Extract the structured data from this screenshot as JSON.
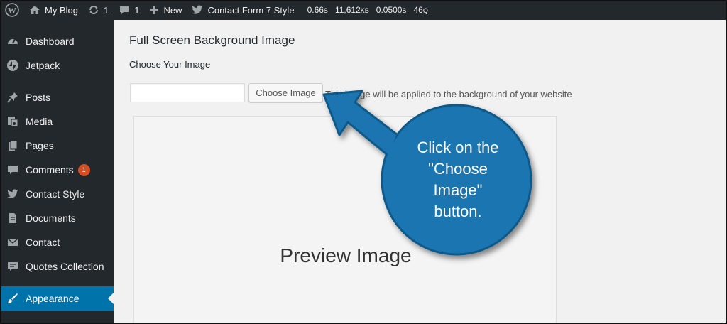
{
  "adminbar": {
    "site_name": "My Blog",
    "updates_count": "1",
    "comments_count": "1",
    "new_label": "New",
    "plugin_label": "Contact Form 7 Style",
    "stats": {
      "time": "0.66",
      "time_unit": "S",
      "memory": "11,612",
      "memory_unit": "KB",
      "query_time": "0.0500",
      "query_time_unit": "S",
      "queries": "46",
      "queries_unit": "Q"
    }
  },
  "sidebar": {
    "items": [
      {
        "label": "Dashboard",
        "icon": "dashboard-icon"
      },
      {
        "label": "Jetpack",
        "icon": "jetpack-icon"
      },
      {
        "label": "Posts",
        "icon": "pin-icon"
      },
      {
        "label": "Media",
        "icon": "media-icon"
      },
      {
        "label": "Pages",
        "icon": "pages-icon"
      },
      {
        "label": "Comments",
        "icon": "comment-icon",
        "badge": "1"
      },
      {
        "label": "Contact Style",
        "icon": "twitter-icon"
      },
      {
        "label": "Documents",
        "icon": "document-icon"
      },
      {
        "label": "Contact",
        "icon": "mail-icon"
      },
      {
        "label": "Quotes Collection",
        "icon": "quote-icon"
      },
      {
        "label": "Appearance",
        "icon": "brush-icon",
        "active": true
      }
    ]
  },
  "main": {
    "title": "Full Screen Background Image",
    "field_label": "Choose Your Image",
    "input_value": "",
    "button_label": "Choose Image",
    "help_text": "This image will be applied to the background of your website",
    "preview_label": "Preview Image"
  },
  "callout": {
    "text_line1": "Click on the",
    "text_line2": "\"Choose",
    "text_line3": "Image\"",
    "text_line4": "button."
  },
  "colors": {
    "adminbar_bg": "#23282d",
    "active_blue": "#0073aa",
    "badge": "#d54e21",
    "callout_blue": "#1a75b0"
  }
}
